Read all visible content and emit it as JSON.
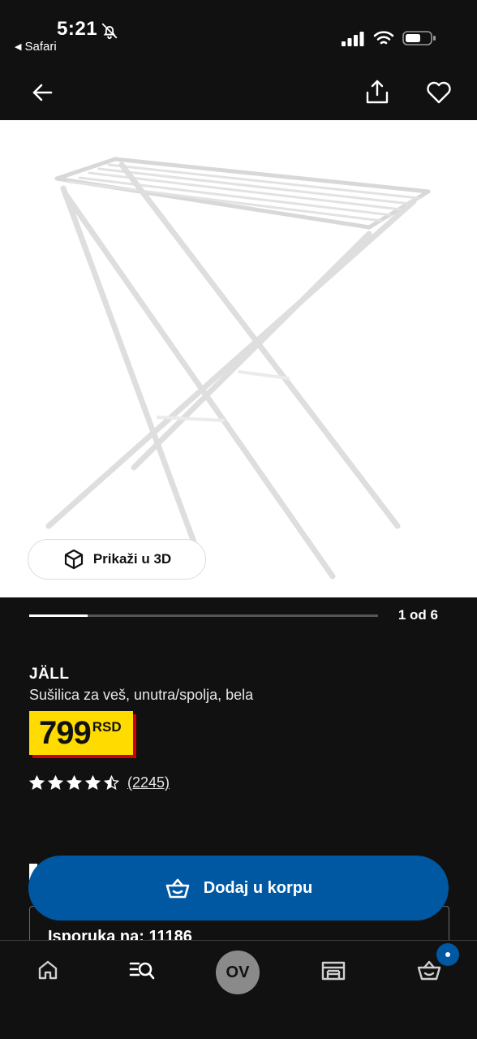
{
  "status_bar": {
    "time": "5:21",
    "back_app": "Safari"
  },
  "product": {
    "name": "JÄLL",
    "description": "Sušilica za veš, unutra/spolja, bela",
    "price": "799",
    "currency": "RSD",
    "rating": 4.5,
    "rating_count": "(2245)"
  },
  "media": {
    "view_3d_label": "Prikaži u 3D",
    "page_indicator": "1 od 6",
    "progress": 0.167
  },
  "actions": {
    "add_to_cart_label": "Dodaj u korpu"
  },
  "delivery": {
    "label": "Isporuka na: 11186"
  },
  "tab_bar": {
    "profile_initials": "OV"
  },
  "colors": {
    "background": "#111111",
    "primary_blue": "#0058a3",
    "price_yellow": "#ffdb00",
    "price_red": "#cc0008"
  },
  "icons": [
    "bell-slash-icon",
    "signal-icon",
    "wifi-icon",
    "battery-icon",
    "back-arrow-icon",
    "share-icon",
    "heart-icon",
    "cube-icon",
    "star-icon",
    "basket-icon",
    "home-icon",
    "search-list-icon",
    "store-icon",
    "cart-icon"
  ]
}
